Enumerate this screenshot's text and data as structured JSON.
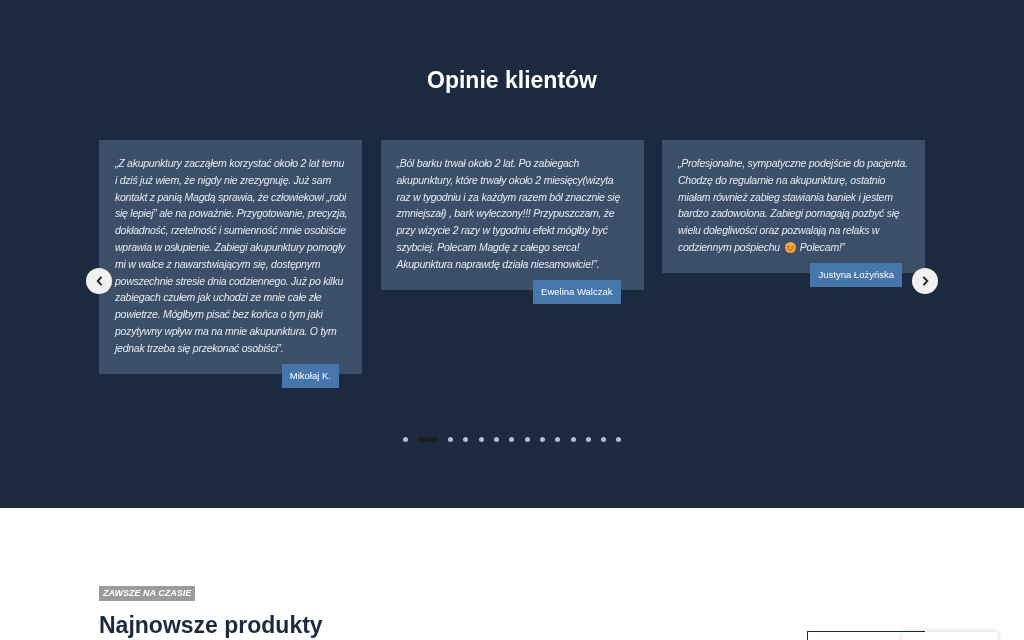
{
  "testimonials": {
    "title": "Opinie klientów",
    "items": [
      {
        "quote": [
          {
            "kind": "text",
            "text": "„Z akupunktury zacząłem korzystać około 2 lat temu i dziś już wiem, że nigdy nie zrezygnuję. Już sam kontakt z panią Magdą sprawia, że człowiekowi „robi się lepiej” ale na poważnie. Przygotowanie, precyzja, dokładność, rzetelność i sumienność mnie osobiście wprawia w osłupienie. Zabiegi akupunktury pomogły mi w walce z nawarstwiającym się, dostępnym powszechnie stresie dnia codziennego. Już po kilku zabiegach czułem jak uchodzi ze mnie całe złe powietrze. Mógłbym pisać bez końca o tym jaki pozytywny wpływ ma na mnie akupunktura. O tym jednak trzeba się przekonać osobiści”."
          }
        ],
        "author": "Mikołaj K."
      },
      {
        "quote": [
          {
            "kind": "text",
            "text": "„Ból barku trwał około 2 lat. Po zabiegach akupunktury, które trwały około 2 miesięcy(wizyta raz w tygodniu i za każdym razem ból znacznie się zmniejszał) , bark wyleczony!!! Przypuszczam, że przy wizycie 2 razy w tygodniu efekt mógłby być szybciej. Polecam Magdę z całego serca! Akupunktura naprawdę działa niesamowicie!”."
          }
        ],
        "author": "Ewelina Walczak"
      },
      {
        "quote": [
          {
            "kind": "text",
            "text": "„Profesjonalne, sympatyczne podejście do pacjenta. Chodzę do regularnie na akupunkturę, ostatnio miałam również zabieg stawiania baniek i jestem bardzo zadowolona. Zabiegi pomagają pozbyć się wielu dolegliwości oraz pozwalają na relaks w codziennym pośpiechu"
          },
          {
            "kind": "emoji"
          },
          {
            "kind": "text",
            "text": "Polecam!”"
          }
        ],
        "author": "Justyna Łożyńska"
      }
    ],
    "dots": [
      {
        "selected": false
      },
      {
        "selected": true
      },
      {
        "selected": false
      },
      {
        "selected": false
      },
      {
        "selected": false
      },
      {
        "selected": false
      },
      {
        "selected": false
      },
      {
        "selected": false
      },
      {
        "selected": false
      },
      {
        "selected": false
      },
      {
        "selected": false
      },
      {
        "selected": false
      },
      {
        "selected": false
      },
      {
        "selected": false
      }
    ]
  },
  "latest": {
    "tag": "ZAWSZE NA CZASIE",
    "title": "Najnowsze produkty"
  }
}
